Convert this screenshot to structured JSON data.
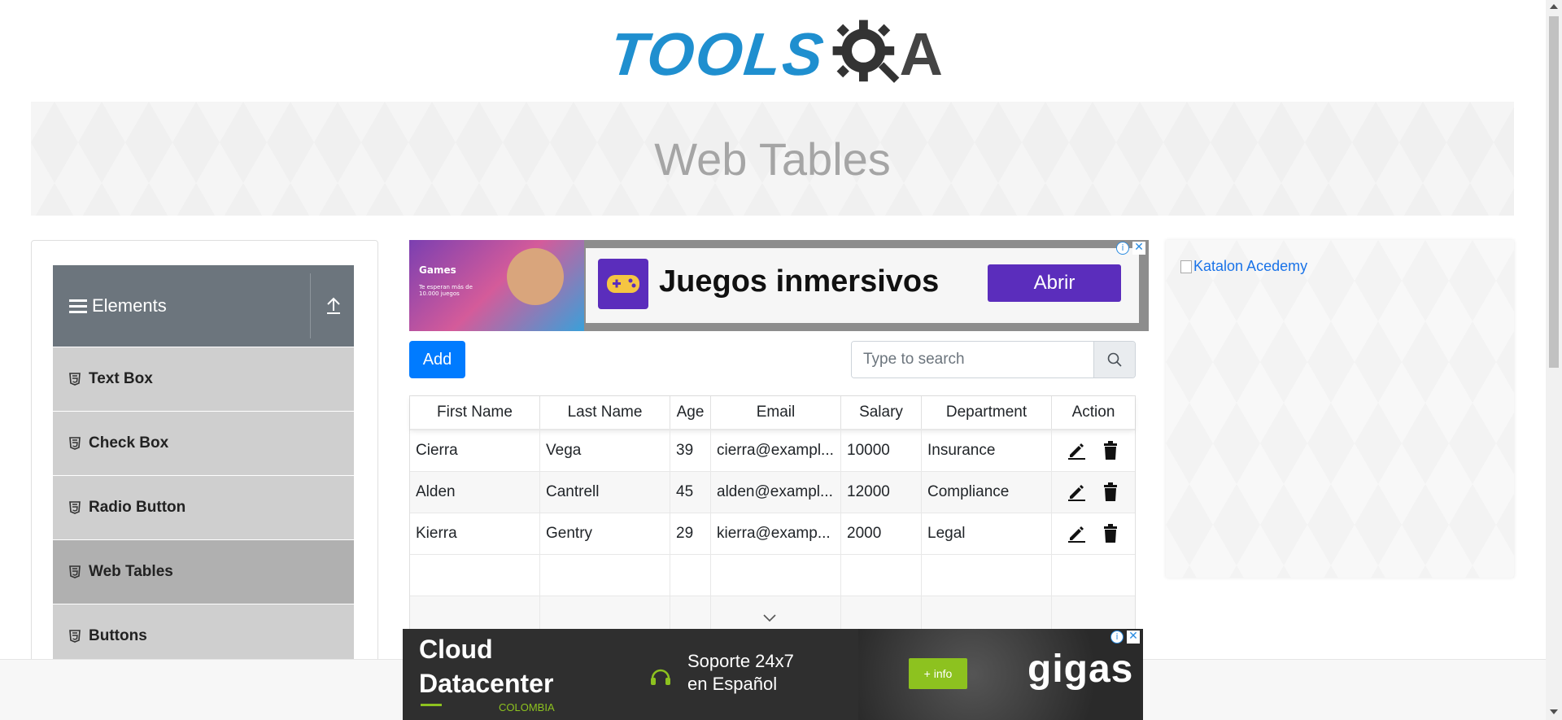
{
  "header": {
    "logo_main": "TOOLS",
    "logo_suffix": "A",
    "page_title": "Web Tables"
  },
  "sidebar": {
    "group_title": "Elements",
    "items": [
      {
        "label": "Text Box",
        "active": false
      },
      {
        "label": "Check Box",
        "active": false
      },
      {
        "label": "Radio Button",
        "active": false
      },
      {
        "label": "Web Tables",
        "active": true
      },
      {
        "label": "Buttons",
        "active": false
      }
    ]
  },
  "top_ad": {
    "brand": "Games",
    "tagline": "Te esperan más de 10.000 juegos",
    "headline": "Juegos inmersivos",
    "cta": "Abrir"
  },
  "toolbar": {
    "add_label": "Add",
    "search_placeholder": "Type to search"
  },
  "table": {
    "columns": [
      "First Name",
      "Last Name",
      "Age",
      "Email",
      "Salary",
      "Department",
      "Action"
    ],
    "rows": [
      {
        "first": "Cierra",
        "last": "Vega",
        "age": "39",
        "email": "cierra@exampl...",
        "salary": "10000",
        "department": "Insurance"
      },
      {
        "first": "Alden",
        "last": "Cantrell",
        "age": "45",
        "email": "alden@exampl...",
        "salary": "12000",
        "department": "Compliance"
      },
      {
        "first": "Kierra",
        "last": "Gentry",
        "age": "29",
        "email": "kierra@examp...",
        "salary": "2000",
        "department": "Legal"
      }
    ]
  },
  "right_ad": {
    "broken_image_alt": "Katalon Acedemy"
  },
  "bottom_ad": {
    "line1": "Cloud",
    "line2": "Datacenter",
    "country": "COLOMBIA",
    "support_line1": "Soporte 24x7",
    "support_line2": "en Español",
    "cta": "+ info",
    "brand": "gigas"
  },
  "colors": {
    "primary": "#007bff",
    "logo_blue": "#1f8fcf",
    "sidebar_header": "#6c757d",
    "menu_item": "#cfcfcf",
    "menu_item_active": "#b0b0b0",
    "ad_purple": "#5b2dbc",
    "ad_green": "#8dc21f"
  }
}
